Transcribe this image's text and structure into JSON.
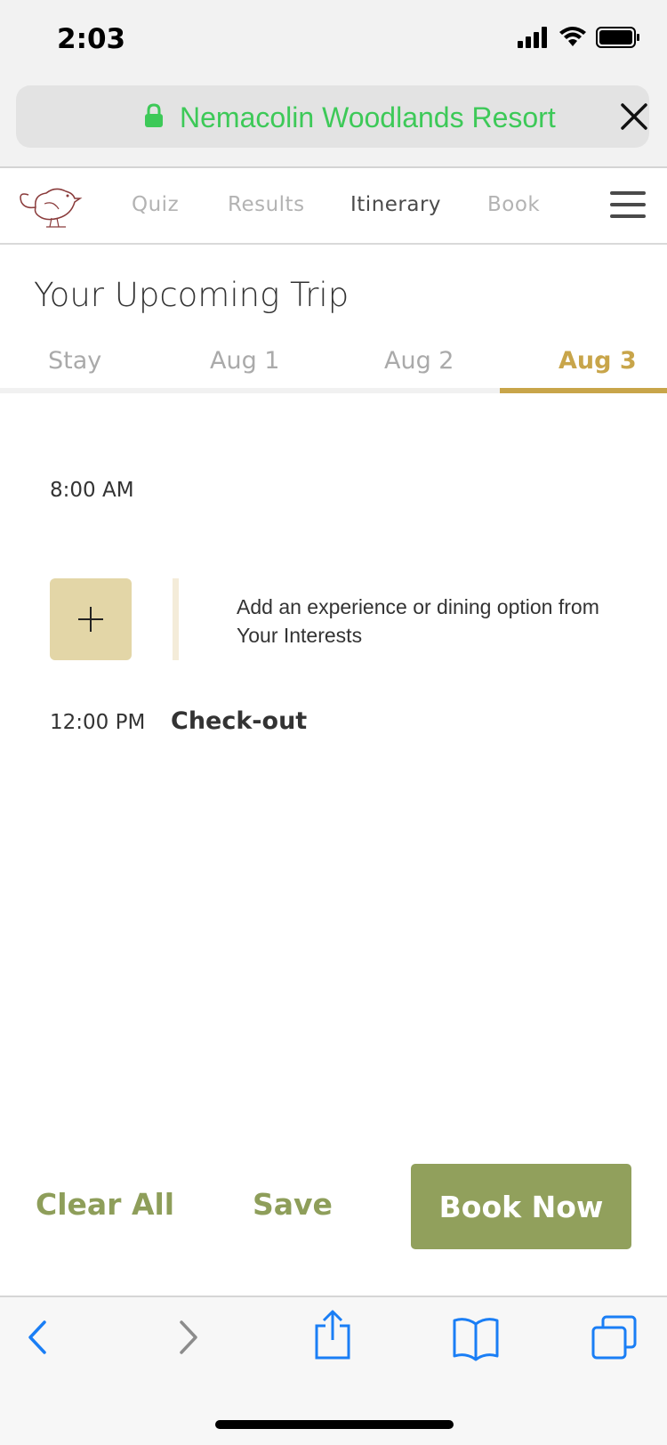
{
  "status": {
    "time": "2:03"
  },
  "browser": {
    "url_title": "Nemacolin Woodlands Resort"
  },
  "nav": {
    "items": [
      {
        "label": "Quiz"
      },
      {
        "label": "Results"
      },
      {
        "label": "Itinerary"
      },
      {
        "label": "Book"
      }
    ],
    "active": "Itinerary"
  },
  "page": {
    "title": "Your Upcoming Trip"
  },
  "tabs": {
    "items": [
      {
        "label": "Stay"
      },
      {
        "label": "Aug 1"
      },
      {
        "label": "Aug 2"
      },
      {
        "label": "Aug 3"
      }
    ],
    "active": "Aug 3",
    "accent_color": "#c8a54a"
  },
  "timeline": {
    "slot1_time": "8:00 AM",
    "add_hint": "Add an experience or dining option from Your Interests",
    "slot2_time": "12:00 PM",
    "slot2_event": "Check-out"
  },
  "actions": {
    "clear_all": "Clear All",
    "save": "Save",
    "book_now": "Book Now",
    "brand_color": "#91a05c"
  }
}
